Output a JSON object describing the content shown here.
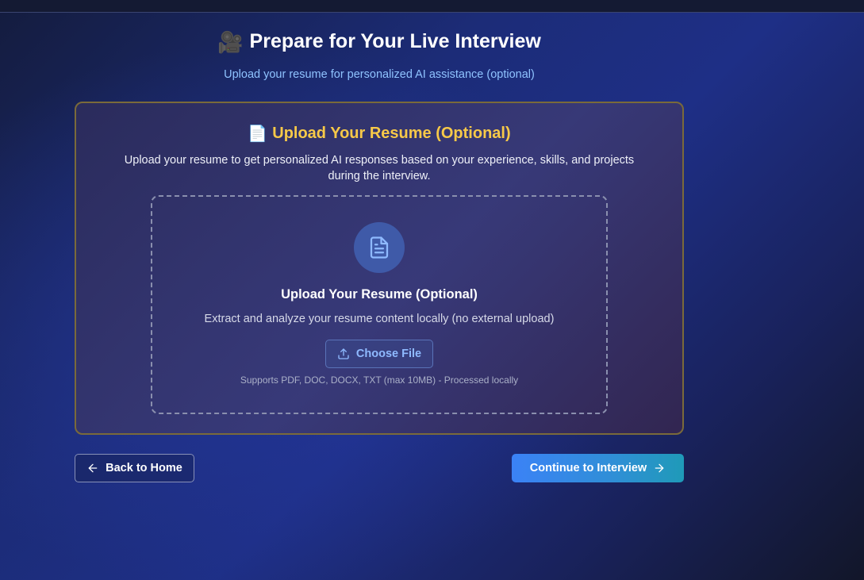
{
  "header": {
    "title_icon": "🎥",
    "title": "Prepare for Your Live Interview",
    "subtitle": "Upload your resume for personalized AI assistance (optional)"
  },
  "card": {
    "title_icon": "📄",
    "title": "Upload Your Resume (Optional)",
    "description": "Upload your resume to get personalized AI responses based on your experience, skills, and projects during the interview."
  },
  "dropzone": {
    "icon": "file-text-icon",
    "title": "Upload Your Resume (Optional)",
    "description": "Extract and analyze your resume content locally (no external upload)",
    "button_label": "Choose File",
    "button_icon": "upload-icon",
    "note": "Supports PDF, DOC, DOCX, TXT (max 10MB) - Processed locally"
  },
  "actions": {
    "back_label": "Back to Home",
    "back_icon": "arrow-left-icon",
    "continue_label": "Continue to Interview",
    "continue_icon": "arrow-right-icon"
  },
  "colors": {
    "accent_gold": "#f7c948",
    "subtitle_blue": "#8fc3ff",
    "primary_button": "#3b82f6",
    "background": "#1e2f86"
  }
}
